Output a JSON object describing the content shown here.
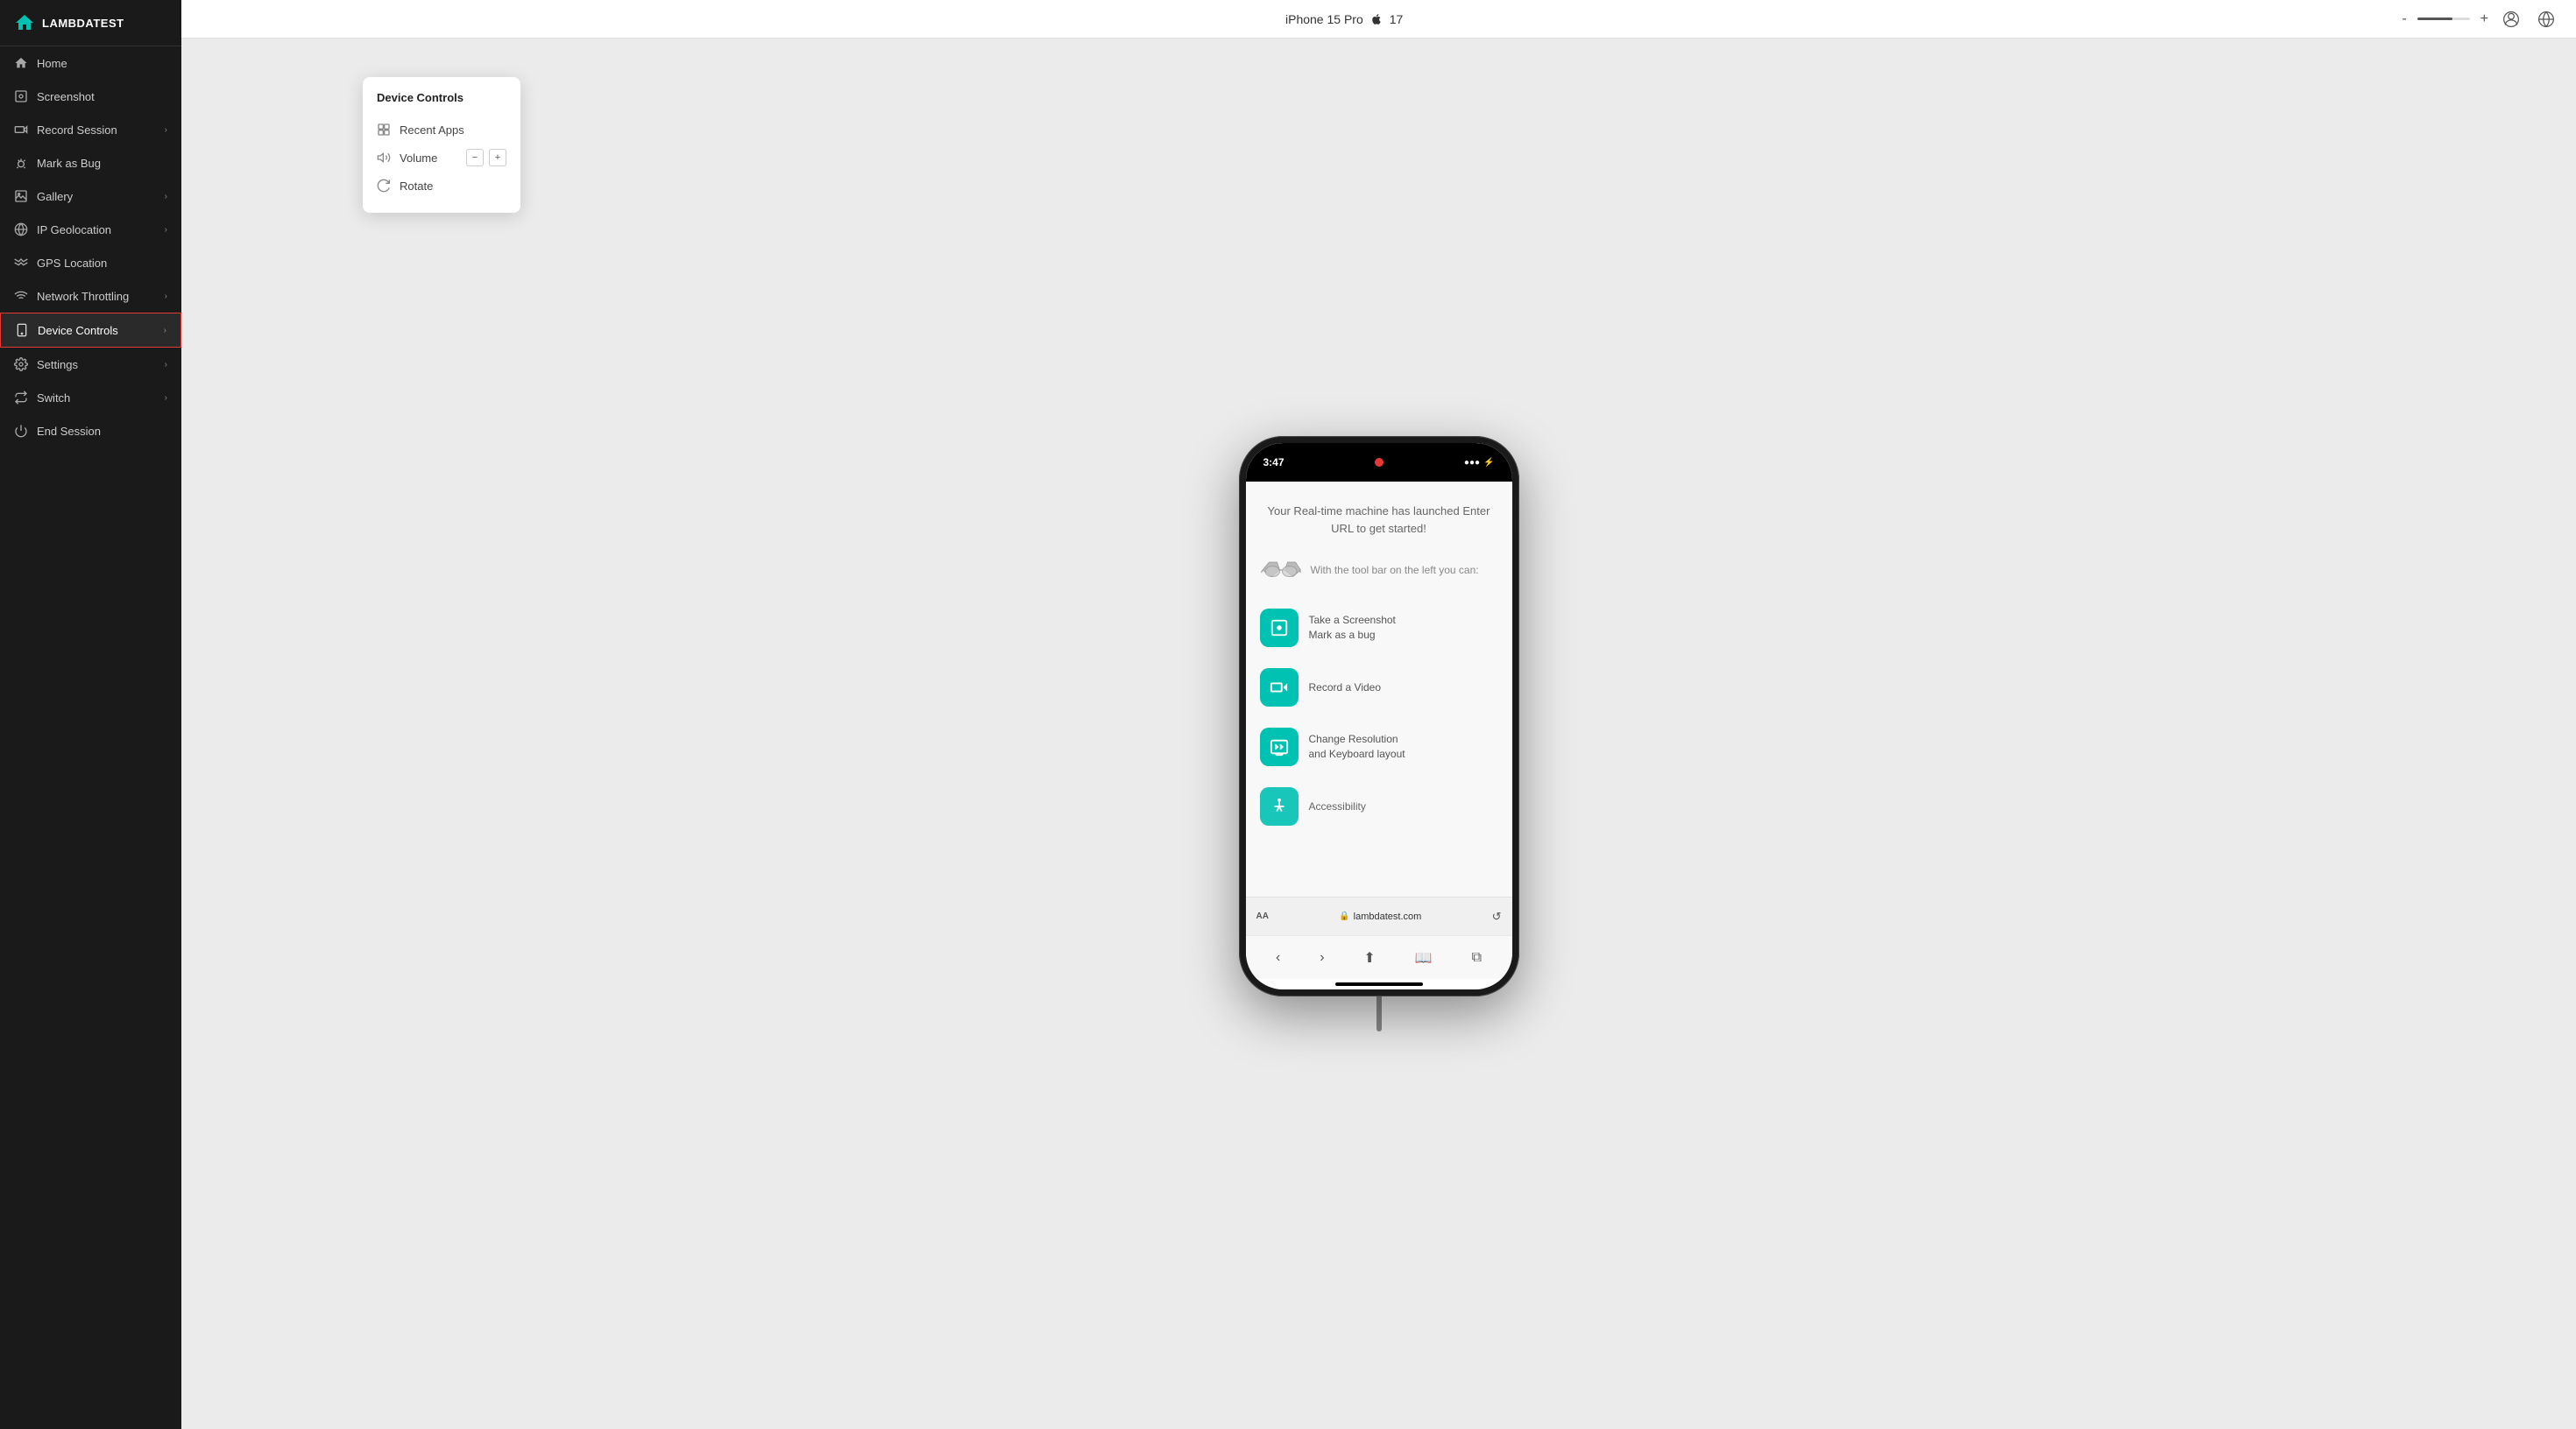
{
  "app": {
    "name": "LAMBDATEST",
    "logo_icon": "home"
  },
  "sidebar": {
    "items": [
      {
        "id": "home",
        "label": "Home",
        "icon": "home",
        "has_chevron": false,
        "active": false
      },
      {
        "id": "screenshot",
        "label": "Screenshot",
        "icon": "screenshot",
        "has_chevron": false,
        "active": false
      },
      {
        "id": "record-session",
        "label": "Record Session",
        "icon": "record",
        "has_chevron": true,
        "active": false
      },
      {
        "id": "mark-as-bug",
        "label": "Mark as Bug",
        "icon": "bug",
        "has_chevron": false,
        "active": false
      },
      {
        "id": "gallery",
        "label": "Gallery",
        "icon": "gallery",
        "has_chevron": true,
        "active": false
      },
      {
        "id": "ip-geolocation",
        "label": "IP Geolocation",
        "icon": "ip",
        "has_chevron": true,
        "active": false
      },
      {
        "id": "gps-location",
        "label": "GPS Location",
        "icon": "gps",
        "has_chevron": false,
        "active": false
      },
      {
        "id": "network-throttling",
        "label": "Network Throttling",
        "icon": "network",
        "has_chevron": true,
        "active": false
      },
      {
        "id": "device-controls",
        "label": "Device Controls",
        "icon": "device",
        "has_chevron": true,
        "active": true
      },
      {
        "id": "settings",
        "label": "Settings",
        "icon": "settings",
        "has_chevron": true,
        "active": false
      },
      {
        "id": "switch",
        "label": "Switch",
        "icon": "switch",
        "has_chevron": true,
        "active": false
      },
      {
        "id": "end-session",
        "label": "End Session",
        "icon": "power",
        "has_chevron": false,
        "active": false
      }
    ]
  },
  "topbar": {
    "device_name": "iPhone 15 Pro",
    "os_icon": "apple",
    "os_version": "17",
    "zoom_minus": "-",
    "zoom_plus": "+"
  },
  "device_controls_popup": {
    "title": "Device Controls",
    "items": [
      {
        "id": "recent-apps",
        "label": "Recent Apps",
        "icon": "recent"
      },
      {
        "id": "volume",
        "label": "Volume",
        "icon": "volume",
        "has_controls": true,
        "minus_label": "−",
        "plus_label": "+"
      },
      {
        "id": "rotate",
        "label": "Rotate",
        "icon": "rotate"
      }
    ]
  },
  "phone": {
    "status_time": "3:47",
    "url": "lambdatest.com",
    "welcome_text": "Your Real-time machine has launched Enter URL to get started!",
    "toolbar_hint": "With the tool bar on the left you can:",
    "features": [
      {
        "id": "screenshot-bug",
        "icon": "screenshot",
        "text": "Take a Screenshot\nMark as a bug"
      },
      {
        "id": "record-video",
        "icon": "video",
        "text": "Record a Video"
      },
      {
        "id": "resolution",
        "icon": "resolution",
        "text": "Change Resolution\nand Keyboard layout"
      },
      {
        "id": "accessibility",
        "icon": "accessibility",
        "text": "Accessibility"
      }
    ]
  }
}
